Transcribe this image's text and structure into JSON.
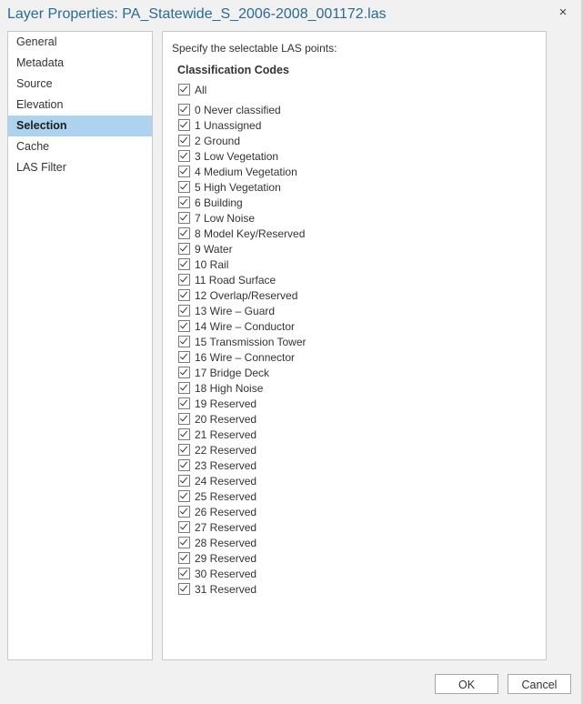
{
  "window": {
    "title": "Layer Properties: PA_Statewide_S_2006-2008_001172.las",
    "close_icon": "×"
  },
  "sidebar": {
    "items": [
      {
        "label": "General",
        "selected": false
      },
      {
        "label": "Metadata",
        "selected": false
      },
      {
        "label": "Source",
        "selected": false
      },
      {
        "label": "Elevation",
        "selected": false
      },
      {
        "label": "Selection",
        "selected": true
      },
      {
        "label": "Cache",
        "selected": false
      },
      {
        "label": "LAS Filter",
        "selected": false
      }
    ]
  },
  "main": {
    "heading": "Specify the selectable LAS points:",
    "group_label": "Classification Codes",
    "all": {
      "label": "All",
      "checked": true
    },
    "codes": [
      {
        "label": "0 Never classified",
        "checked": true
      },
      {
        "label": "1 Unassigned",
        "checked": true
      },
      {
        "label": "2 Ground",
        "checked": true
      },
      {
        "label": "3 Low Vegetation",
        "checked": true
      },
      {
        "label": "4 Medium Vegetation",
        "checked": true
      },
      {
        "label": "5 High Vegetation",
        "checked": true
      },
      {
        "label": "6 Building",
        "checked": true
      },
      {
        "label": "7 Low Noise",
        "checked": true
      },
      {
        "label": "8 Model Key/Reserved",
        "checked": true
      },
      {
        "label": "9 Water",
        "checked": true
      },
      {
        "label": "10 Rail",
        "checked": true
      },
      {
        "label": "11 Road Surface",
        "checked": true
      },
      {
        "label": "12 Overlap/Reserved",
        "checked": true
      },
      {
        "label": "13 Wire – Guard",
        "checked": true
      },
      {
        "label": "14 Wire – Conductor",
        "checked": true
      },
      {
        "label": "15 Transmission Tower",
        "checked": true
      },
      {
        "label": "16 Wire – Connector",
        "checked": true
      },
      {
        "label": "17 Bridge Deck",
        "checked": true
      },
      {
        "label": "18 High Noise",
        "checked": true
      },
      {
        "label": "19 Reserved",
        "checked": true
      },
      {
        "label": "20 Reserved",
        "checked": true
      },
      {
        "label": "21 Reserved",
        "checked": true
      },
      {
        "label": "22 Reserved",
        "checked": true
      },
      {
        "label": "23 Reserved",
        "checked": true
      },
      {
        "label": "24 Reserved",
        "checked": true
      },
      {
        "label": "25 Reserved",
        "checked": true
      },
      {
        "label": "26 Reserved",
        "checked": true
      },
      {
        "label": "27 Reserved",
        "checked": true
      },
      {
        "label": "28 Reserved",
        "checked": true
      },
      {
        "label": "29 Reserved",
        "checked": true
      },
      {
        "label": "30 Reserved",
        "checked": true
      },
      {
        "label": "31 Reserved",
        "checked": true
      }
    ]
  },
  "footer": {
    "ok_label": "OK",
    "cancel_label": "Cancel"
  },
  "colors": {
    "title": "#2b6a93",
    "selected_item_bg": "#aed3ef"
  }
}
